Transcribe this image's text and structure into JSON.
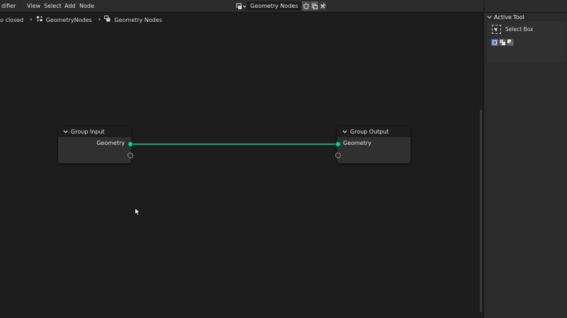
{
  "header": {
    "editor_type_label": "",
    "menus": [
      "difier",
      "View",
      "Select",
      "Add",
      "Node"
    ],
    "tree_selector": {
      "name": "Geometry Nodes",
      "type_icon": "node-tree-icon",
      "fake_user_icon": "shield-icon",
      "duplicate_icon": "copy-icon",
      "unlink_icon": "close-icon"
    },
    "pin_icon": "pin-icon"
  },
  "breadcrumb": {
    "items": [
      "o closed",
      "GeometryNodes",
      "Geometry Nodes"
    ]
  },
  "nodes": {
    "group_input": {
      "title": "Group Input",
      "output_label": "Geometry"
    },
    "group_output": {
      "title": "Group Output",
      "input_label": "Geometry"
    }
  },
  "sidebar": {
    "panel_title": "Active Tool",
    "tool_name": "Select Box"
  },
  "colors": {
    "geometry_socket": "#00d6a3",
    "link": "#27c7a0",
    "canvas_bg": "#1d1d1d",
    "header_bg": "#2b2b2b",
    "active_button": "#4772b3"
  }
}
